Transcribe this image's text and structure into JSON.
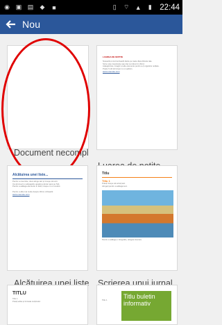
{
  "status_bar": {
    "time": "22:44",
    "left_icons": [
      "whatsapp-icon",
      "media-icon",
      "image-icon",
      "android-icon",
      "office-icon"
    ],
    "right_icons": [
      "vibrate-icon",
      "wifi-icon",
      "signal-icon",
      "battery-icon"
    ]
  },
  "app_bar": {
    "title": "Nou",
    "back_icon": "arrow-left-icon",
    "background": "#2b579a"
  },
  "templates": [
    {
      "label": "Document necompl",
      "selected": true
    },
    {
      "label": "Luarea de notițe",
      "thumb": {
        "title": "LUAREA DE NOTIȚE",
        "lines": [
          "Notează și sincronizează ideile pe toate dispozitivele tale.",
          "Scrie note importante sau idei noi direct în Word.",
          "Adaugă liste, imagini și alte elemente pentru a-ți organiza notițele.",
          "Poate fi util să începi cu un șablon."
        ],
        "link": "www.onenote.com"
      }
    },
    {
      "label": "Alcătuirea unei liste",
      "thumb": {
        "title": "Alcătuirea unei liste...",
        "lines": [
          "Pentru a crea liste, doar atinge aici și începe să scrii.",
          "Ca să creezi o subpagină, apasă pe Enter apoi pe Tab.",
          "Pentru a adăuga elemente în listă, începe cu un cuvânt."
        ],
        "footer": "Pentru a afla mai multe despre Word, vizitează:",
        "link": "www.onenote.com"
      }
    },
    {
      "label": "Scrierea unui jurnal",
      "thumb": {
        "title": "Titlu",
        "heading": "Titlu 1",
        "lines": [
          "Puteți începe să scrieți aici.",
          "Atingeți pentru a adăuga text.",
          "Pentru a adăuga o fotografie, atingeți Inserare."
        ]
      }
    },
    {
      "label": "",
      "thumb": {
        "title": "TITLU",
        "lines": [
          "Titlu 1",
          "Puteți edita și formata conținutul."
        ]
      }
    },
    {
      "label": "",
      "thumb": {
        "title": "Titlu buletin informativ",
        "lines": [
          "Titlu 1"
        ]
      }
    }
  ]
}
